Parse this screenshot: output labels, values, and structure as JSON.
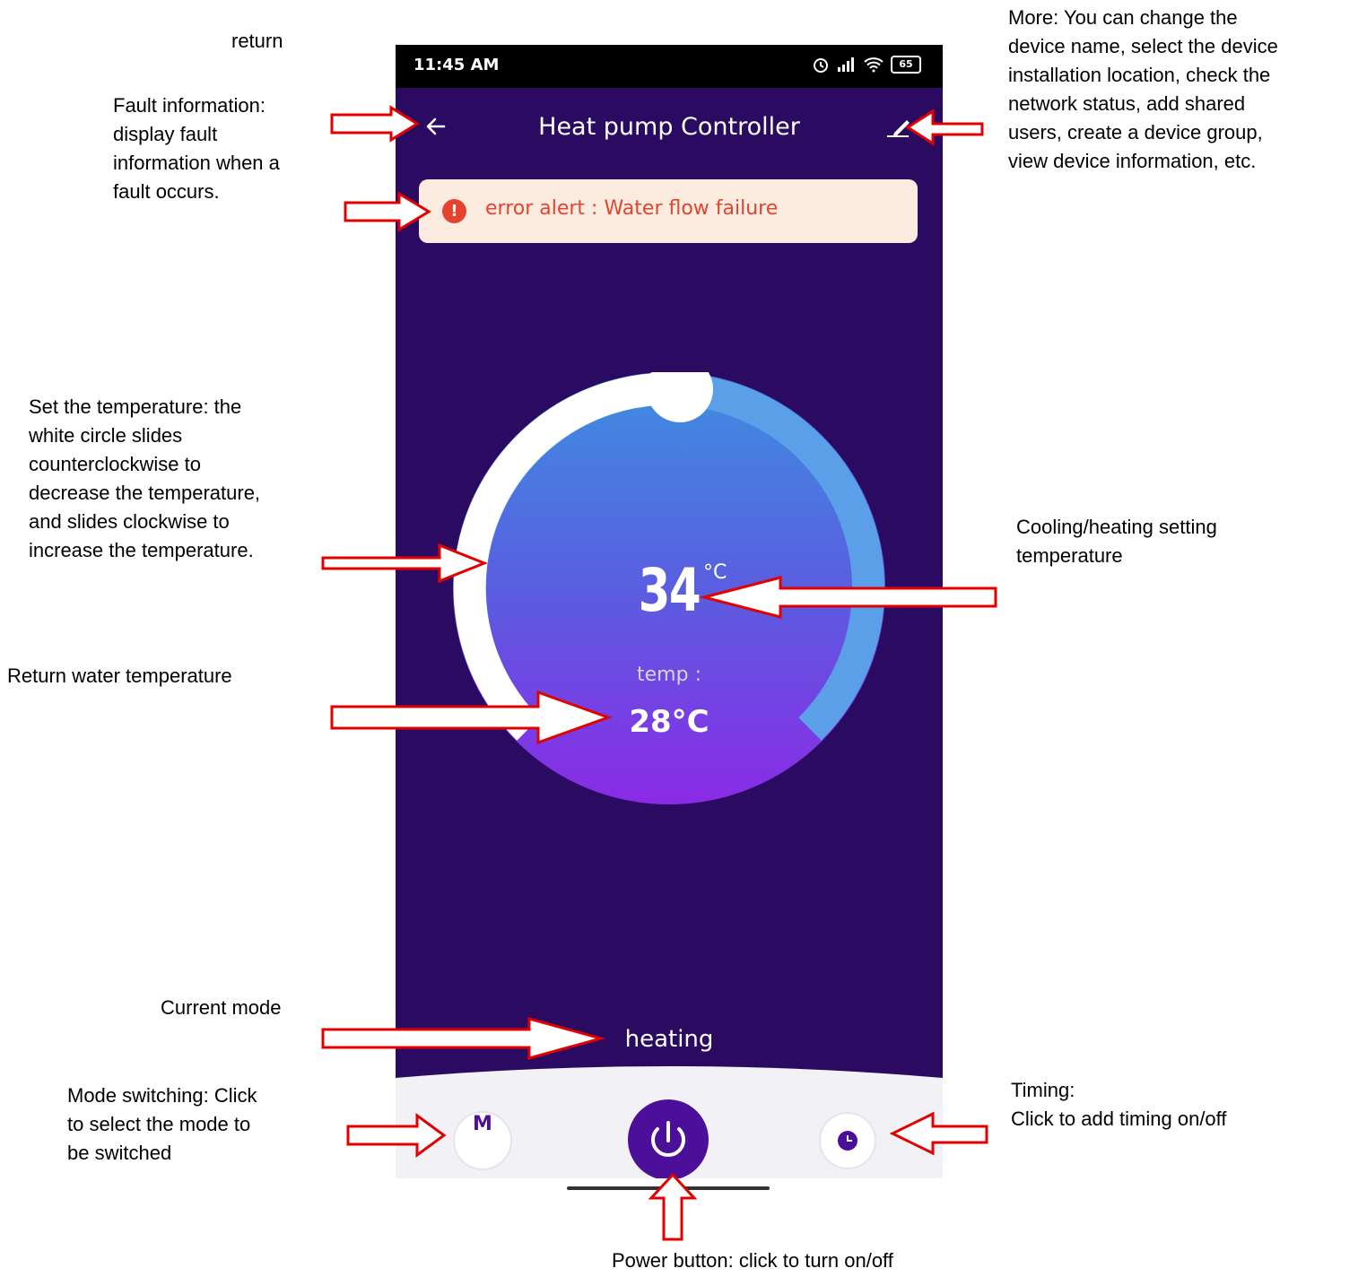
{
  "annotations": {
    "return": "return",
    "fault_info": "Fault information:\ndisplay fault\ninformation when a\nfault occurs.",
    "more": "More: You can change the\ndevice name, select the device\ninstallation location, check the\nnetwork status, add shared\nusers, create a device group,\nview device information, etc.",
    "set_temp": "Set the temperature: the\nwhite circle slides\ncounterclockwise to\ndecrease the temperature,\nand slides clockwise to\nincrease the temperature.",
    "cooling_heating": "Cooling/heating setting\ntemperature",
    "return_water": "Return water temperature",
    "current_mode": "Current mode",
    "mode_switching": "Mode switching: Click\nto select the mode to\nbe switched",
    "timing": "Timing:\nClick to add timing on/off",
    "power": "Power button: click to turn on/off"
  },
  "status_bar": {
    "time": "11:45 AM",
    "battery": "65"
  },
  "header": {
    "title": "Heat pump Controller"
  },
  "alert": {
    "text": "error alert : Water flow failure"
  },
  "dial": {
    "set_temp": "34",
    "unit": "°C",
    "temp_label": "temp :",
    "current_temp": "28°C"
  },
  "mode": {
    "current": "heating",
    "button_label": "M"
  },
  "colors": {
    "background": "#2b0b62",
    "accent": "#4b0f9a",
    "alert_bg": "#fcece0",
    "alert_text": "#e6432f",
    "arrow": "#e30000"
  },
  "icons": [
    "back-arrow-icon",
    "edit-pencil-icon",
    "error-icon",
    "power-icon",
    "clock-icon",
    "alarm-icon",
    "signal-icon",
    "wifi-icon",
    "battery-icon"
  ]
}
